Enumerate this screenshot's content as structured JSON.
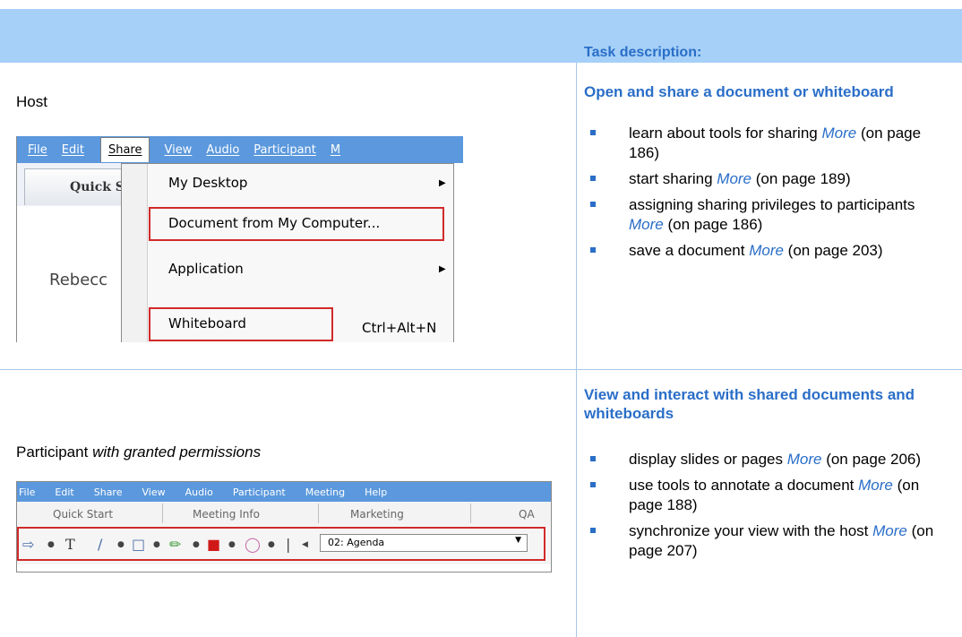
{
  "header": {
    "task_heading": "Task description:"
  },
  "host": {
    "label": "Host",
    "menu": [
      "File",
      "Edit",
      "Share",
      "View",
      "Audio",
      "Participant",
      "M"
    ],
    "tab_label": "Quick S",
    "host_name": "Rebecc",
    "dropdown": {
      "item1": "My Desktop",
      "item2": "Document from My Computer...",
      "item3": "Application",
      "item4": "Whiteboard",
      "item4_shortcut": "Ctrl+Alt+N"
    }
  },
  "participant": {
    "label_prefix": "Participant",
    "label_italic": "with granted permissions",
    "menu": [
      "File",
      "Edit",
      "Share",
      "View",
      "Audio",
      "Participant",
      "Meeting",
      "Help"
    ],
    "tabs": [
      "Quick Start",
      "Meeting Info",
      "Marketing",
      "QA"
    ],
    "toolbar_page": "02: Agenda"
  },
  "sections": [
    {
      "title": "Open and share a document or whiteboard",
      "items": [
        {
          "text": "learn about tools for sharing",
          "more": "More",
          "ref": "(on page 186)"
        },
        {
          "text": "start sharing",
          "more": "More",
          "ref": "(on page 189)"
        },
        {
          "text": "assigning sharing privileges to participants",
          "more": "More",
          "ref": "(on page 186)"
        },
        {
          "text": "save a document",
          "more": "More",
          "ref": "(on page 203)"
        }
      ]
    },
    {
      "title": "View and interact with shared documents and whiteboards",
      "items": [
        {
          "text": "display slides or pages",
          "more": "More",
          "ref": "(on page 206)"
        },
        {
          "text": "use tools to annotate a document",
          "more": "More",
          "ref": "(on page 188)"
        },
        {
          "text": "synchronize your view with the host",
          "more": "More",
          "ref": "(on page 207)"
        }
      ]
    }
  ]
}
